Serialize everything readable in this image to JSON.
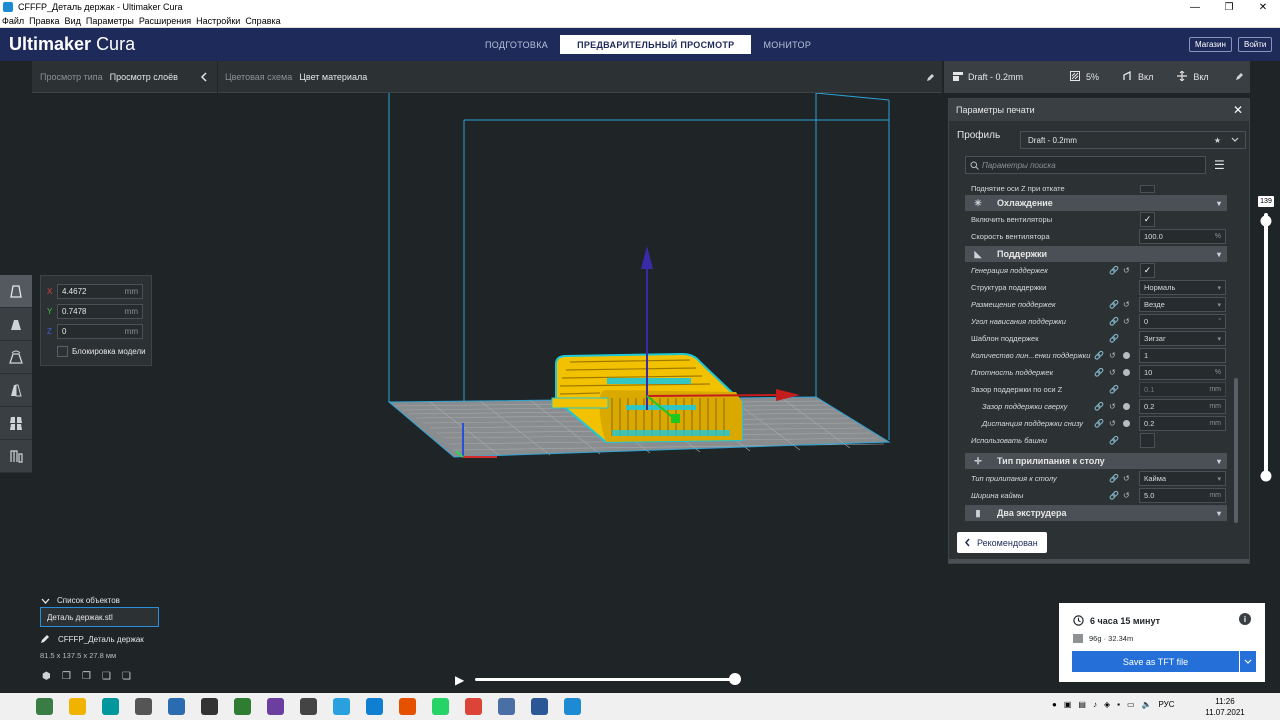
{
  "window": {
    "title": "CFFFP_Деталь держак - Ultimaker Cura",
    "controls": [
      "—",
      "❐",
      "✕"
    ]
  },
  "menu": [
    "Файл",
    "Правка",
    "Вид",
    "Параметры",
    "Расширения",
    "Настройки",
    "Справка"
  ],
  "header": {
    "brand_bold": "Ultimaker",
    "brand_light": "Cura",
    "tabs": [
      "ПОДГОТОВКА",
      "ПРЕДВАРИТЕЛЬНЫЙ ПРОСМОТР",
      "МОНИТОР"
    ],
    "active_tab": 1,
    "store_label": "Магазин",
    "login_label": "Войти"
  },
  "view_bar": {
    "view_type_label": "Просмотр типа",
    "view_type_value": "Просмотр слоёв",
    "color_scheme_label": "Цветовая схема",
    "color_scheme_value": "Цвет материала"
  },
  "print_bar": {
    "profile": "Draft - 0.2mm",
    "infill": "5%",
    "support": "Вкл",
    "adhesion": "Вкл"
  },
  "move_panel": {
    "x": "4.4672",
    "y": "0.7478",
    "z": "0",
    "unit": "mm",
    "lock_label": "Блокировка модели",
    "axis_x": "X",
    "axis_y": "Y",
    "axis_z": "Z"
  },
  "print_settings": {
    "title": "Параметры печати",
    "profile_label": "Профиль",
    "profile_value": "Draft - 0.2mm",
    "search_placeholder": "Параметры поиска",
    "rows": {
      "z_hop": "Поднятие оси Z при откате",
      "cooling": "Охлаждение",
      "fan_enable": "Включить вентиляторы",
      "fan_speed": "Скорость вентилятора",
      "fan_speed_val": "100.0",
      "support": "Поддержки",
      "support_gen": "Генерация поддержек",
      "support_struct": "Структура поддержки",
      "support_struct_val": "Нормаль",
      "support_place": "Размещение поддержек",
      "support_place_val": "Везде",
      "overhang": "Угол нависания поддержки",
      "overhang_val": "0",
      "support_pattern": "Шаблон поддержек",
      "support_pattern_val": "Зигзаг",
      "wall_count": "Количество лин...енки поддержки",
      "wall_count_val": "1",
      "density": "Плотность поддержек",
      "density_val": "10",
      "z_dist": "Зазор поддержки по оси Z",
      "z_dist_val": "0.1",
      "top_dist": "Зазор поддержки сверху",
      "top_dist_val": "0.2",
      "bottom_dist": "Дистанция поддержки снизу",
      "bottom_dist_val": "0.2",
      "towers": "Использовать башни",
      "adhesion": "Тип прилипания к столу",
      "adhesion_type": "Тип прилипания к столу",
      "adhesion_type_val": "Кайма",
      "brim_width": "Ширина каймы",
      "brim_width_val": "5.0",
      "dual": "Два экструдера"
    },
    "unit_mm": "mm",
    "unit_pct": "%",
    "unit_deg": "°",
    "recommended_label": "Рекомендован"
  },
  "layer_slider": {
    "value": "139"
  },
  "objects": {
    "title": "Список объектов",
    "item": "Деталь держак.stl",
    "name": "CFFFP_Деталь держак",
    "dims": "81.5 x 137.5 x 27.8 мм"
  },
  "estimate": {
    "time": "6 часа 15 минут",
    "material": "96g · 32.34m",
    "save_label": "Save as TFT file"
  },
  "taskbar": {
    "lang": "РУС",
    "time": "11:26",
    "date": "11.07.2021",
    "icon_colors": [
      "#3a7d44",
      "#f0b400",
      "#00979d",
      "#555",
      "#2b6cb0",
      "#333",
      "#2e7d32",
      "#6b3fa0",
      "#444",
      "#2aa1de",
      "#0e7fd1",
      "#e65100",
      "#25d366",
      "#db4437",
      "#4a6fa5",
      "#2b5797",
      "#1d8bd3"
    ]
  },
  "colors": {
    "accent": "#2470d8",
    "header": "#1e2a5a",
    "model_yellow": "#f2c200",
    "model_cyan": "#1ec8d8"
  }
}
